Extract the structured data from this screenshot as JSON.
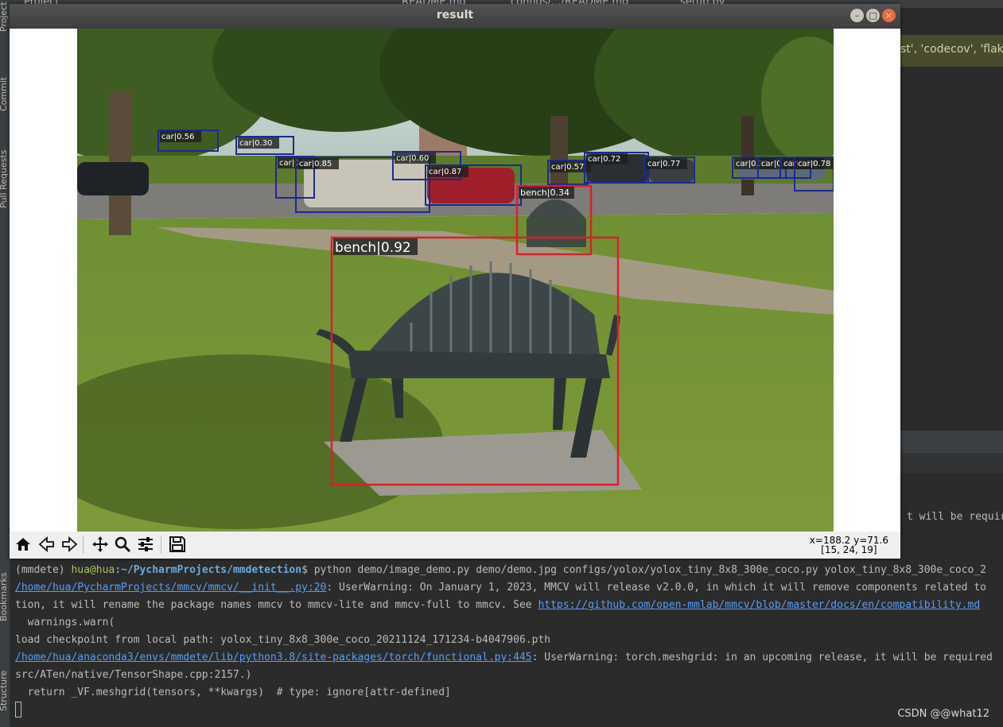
{
  "ide": {
    "top_tabs": [
      "Project",
      "README.md",
      "configs/.../README.md",
      "setup.py"
    ],
    "left_tabs": [
      "Project",
      "Commit",
      "Pull Requests",
      "Bookmarks",
      "Structure"
    ],
    "editor_fragment": "st', 'codecov', 'flak",
    "right_terminal_fragment": "t will be require"
  },
  "window": {
    "title": "result",
    "buttons": {
      "minimize": "–",
      "maximize": "□",
      "close": "×"
    }
  },
  "detections": [
    {
      "label": "car|0.56"
    },
    {
      "label": "car|0.30"
    },
    {
      "label": "car|0.56"
    },
    {
      "label": "car|0.85"
    },
    {
      "label": "car|0.60"
    },
    {
      "label": "car|0.87"
    },
    {
      "label": "car|0.57"
    },
    {
      "label": "car|0.72"
    },
    {
      "label": "car|0.77"
    },
    {
      "label": "car|0.31"
    },
    {
      "label": "car|0.43"
    },
    {
      "label": "car|0.54"
    },
    {
      "label": "car|0.78"
    },
    {
      "label": "bench|0.34"
    },
    {
      "label": "bench|0.92"
    }
  ],
  "colors": {
    "car_box": "#1c2a8c",
    "bench_box": "#dc1e2e",
    "label_bg": "#1e1e1e"
  },
  "toolbar": {
    "icons": [
      "home-icon",
      "back-icon",
      "forward-icon",
      "pan-icon",
      "zoom-icon",
      "configure-icon",
      "save-icon"
    ],
    "coords_line1": "x=188.2 y=71.6",
    "coords_line2": "[15, 24, 19]"
  },
  "terminal": {
    "line1_env": "(mmdete) ",
    "line1_user": "hua@hua",
    "line1_path": ":~/PycharmProjects/mmdetection",
    "line1_cmd": "$ python demo/image_demo.py demo/demo.jpg configs/yolox/yolox_tiny_8x8_300e_coco.py yolox_tiny_8x8_300e_coco_2",
    "line2_link": "/home/hua/PycharmProjects/mmcv/mmcv/__init__.py:20",
    "line2_text": ": UserWarning: On January 1, 2023, MMCV will release v2.0.0, in which it will remove components related to",
    "line3_text": "tion, it will rename the package names mmcv to mmcv-lite and mmcv-full to mmcv. See ",
    "line3_link": "https://github.com/open-mmlab/mmcv/blob/master/docs/en/compatibility.md",
    "line4_text": "  warnings.warn(",
    "line5_text": "load checkpoint from local path: yolox_tiny_8x8_300e_coco_20211124_171234-b4047906.pth",
    "line6_link": "/home/hua/anaconda3/envs/mmdete/lib/python3.8/site-packages/torch/functional.py:445",
    "line6_text": ": UserWarning: torch.meshgrid: in an upcoming release, it will be required",
    "line7_text": "src/ATen/native/TensorShape.cpp:2157.)",
    "line8_text": "  return _VF.meshgrid(tensors, **kwargs)  # type: ignore[attr-defined]"
  },
  "watermark": "CSDN @@what12"
}
